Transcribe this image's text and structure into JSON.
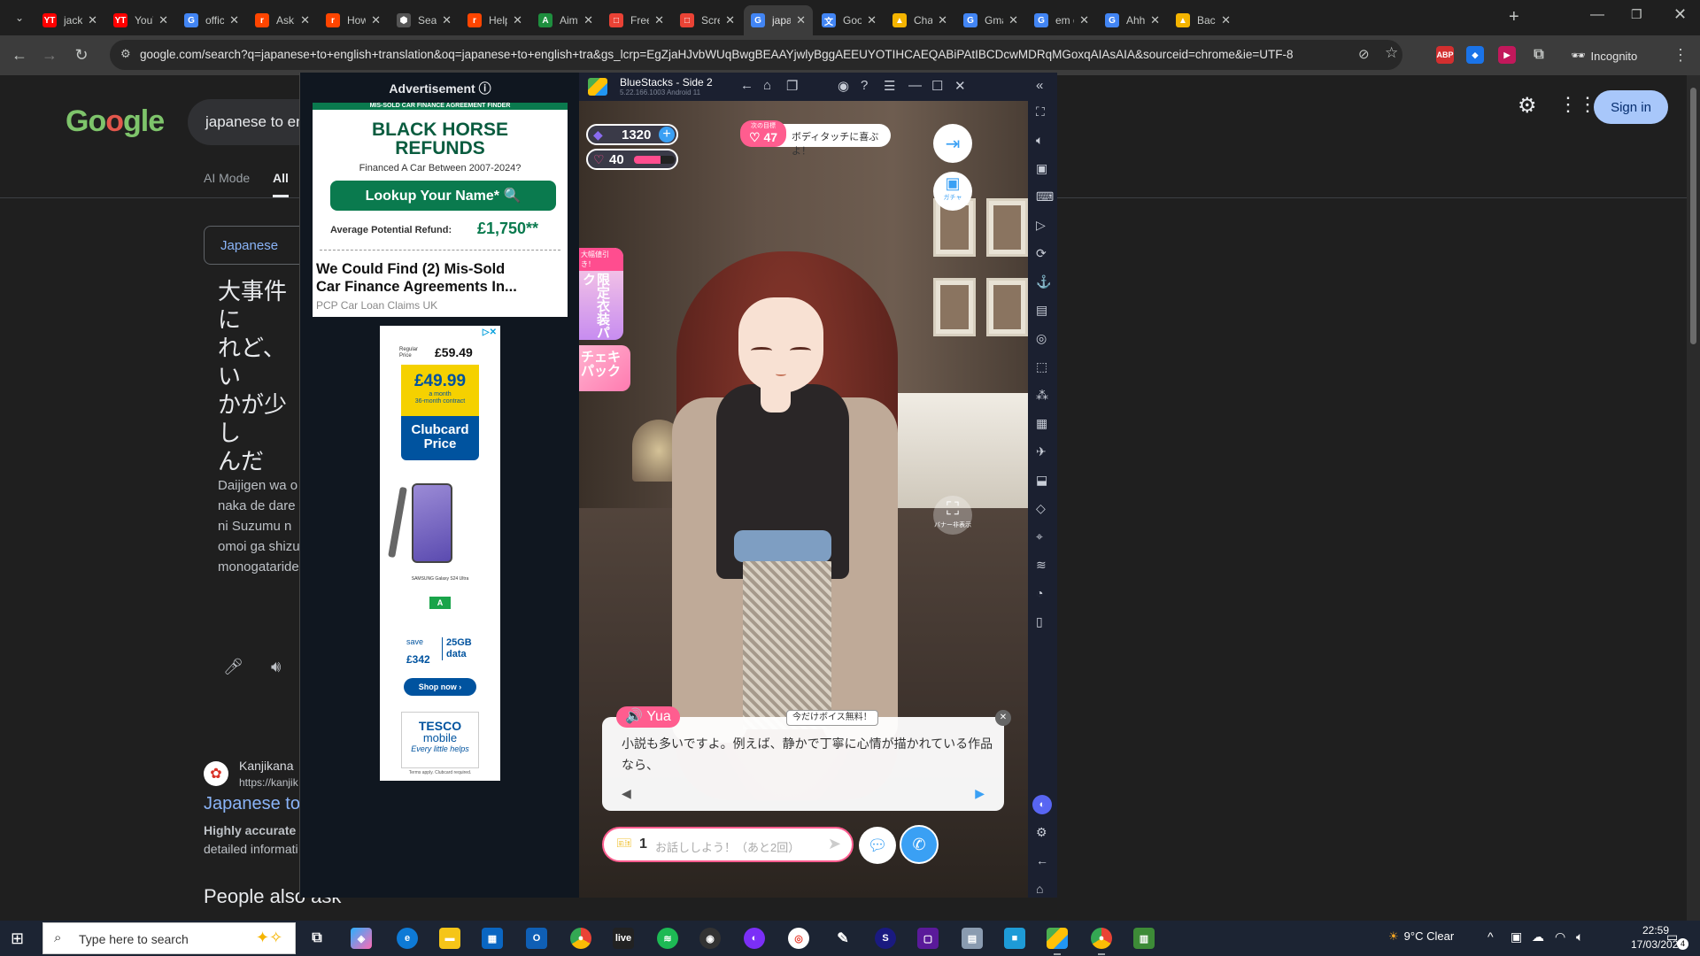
{
  "browser": {
    "tabs": [
      {
        "title": "jack l",
        "fav": "YT",
        "color": "#ff0000"
      },
      {
        "title": "YouT",
        "fav": "YT",
        "color": "#ff0000"
      },
      {
        "title": "offici",
        "fav": "G",
        "color": "#4285f4"
      },
      {
        "title": "AskM",
        "fav": "r",
        "color": "#ff4500"
      },
      {
        "title": "How",
        "fav": "r",
        "color": "#ff4500"
      },
      {
        "title": "Searc",
        "fav": "⬢",
        "color": "#555555"
      },
      {
        "title": "Help",
        "fav": "r",
        "color": "#ff4500"
      },
      {
        "title": "Aimy",
        "fav": "A",
        "color": "#1e8e3e"
      },
      {
        "title": "Freei",
        "fav": "□",
        "color": "#e94235"
      },
      {
        "title": "Scree",
        "fav": "□",
        "color": "#ea4335"
      },
      {
        "title": "japan",
        "fav": "G",
        "color": "#4285f4"
      },
      {
        "title": "Goog",
        "fav": "文",
        "color": "#4285f4"
      },
      {
        "title": "Char",
        "fav": "▲",
        "color": "#f4b400"
      },
      {
        "title": "Gma",
        "fav": "G",
        "color": "#4285f4"
      },
      {
        "title": "em d",
        "fav": "G",
        "color": "#4285f4"
      },
      {
        "title": "Ahh",
        "fav": "G",
        "color": "#4285f4"
      },
      {
        "title": "Back",
        "fav": "▲",
        "color": "#f4b400"
      }
    ],
    "active_tab": 10,
    "new_tab": "+",
    "url": "google.com/search?q=japanese+to+english+translation&oq=japanese+to+english+tra&gs_lcrp=EgZjaHJvbWUqBwgBEAAYjwlyBggAEEUYOTIHCAEQABiPAtIBCDcwMDRqMGoxqAIAsAIA&sourceid=chrome&ie=UTF-8",
    "incognito_label": "Incognito",
    "ext_abp": "ABP"
  },
  "google": {
    "search_value": "japanese to en",
    "tab_ai": "AI Mode",
    "tab_all": "All",
    "sign_in": "Sign in",
    "source_lang": "Japanese",
    "jp_text": "大事件に\nれど、い\nかが少し\nんだり、\nいた想い\nじ合う、\nすね",
    "romaji": "Daijigen wa o\nnaka de dare\nni Suzumu n\nomoi ga shizu\nmonogataride",
    "result_site": "Kanjikana",
    "result_url": "https://kanjik",
    "result_title": "Japanese to",
    "result_snip1": "Highly accurate",
    "result_snip2": "detailed informati",
    "people_ask": "People also ask"
  },
  "ad": {
    "header": "Advertisement ⓘ",
    "ad1_strip": "MIS-SOLD CAR FINANCE AGREEMENT FINDER",
    "ad1_title": "BLACK HORSE\nREFUNDS",
    "ad1_sub": "Financed A Car Between 2007-2024?",
    "ad1_btn": "Lookup Your Name* 🔍",
    "ad1_ref_label": "Average Potential Refund:",
    "ad1_ref_value": "£1,750**",
    "ad1_headline": "We Could Find (2) Mis-Sold\nCar Finance Agreements In...",
    "ad1_source": "PCP Car Loan Claims UK",
    "ad2_regular": "Regular\nPrice",
    "ad2_was": "£59.49",
    "ad2_price": "£49.99",
    "ad2_month": "a month\n36-month contract",
    "ad2_clubcard": "Clubcard\nPrice",
    "ad2_model": "SAMSUNG Galaxy S24 Ultra",
    "ad2_energy": "A",
    "ad2_save": "save",
    "ad2_save_amt": "£342",
    "ad2_data": "25GB\ndata",
    "ad2_shop": "Shop now ›",
    "ad2_tesco": "TESCO",
    "ad2_tesco_sub": "mobile",
    "ad2_tesco_tag": "Every little helps",
    "ad2_terms": "Terms apply. Clubcard required."
  },
  "bluestacks": {
    "title": "BlueStacks - Side 2",
    "version": "5.22.166.1003  Android 11"
  },
  "game": {
    "gems": "1320",
    "hearts": "40",
    "heart_fill_fraction": 0.65,
    "goal_label": "次の目標",
    "goal_num": "47",
    "goal_text": "ボディタッチに喜ぶよ！",
    "gacha_label": "ガチャ",
    "costume_tag": "大幅値引き！",
    "costume_text": "限定衣装パック",
    "cheki_text": "チェキ\nパック",
    "hide_label": "バナー非表示",
    "speaker": "🔊 Yua",
    "voice_tag": "今だけボイス無料！",
    "dialog_text": "小説も多いですよ。例えば、静かで丁寧に心情が描かれている作品なら、",
    "ticket_count": "1",
    "chat_placeholder": "お話ししよう！（あと2回）"
  },
  "taskbar": {
    "search_text": "Type here to search",
    "weather": "9°C  Clear",
    "time": "22:59",
    "date": "17/03/2026",
    "notif_count": "4"
  }
}
